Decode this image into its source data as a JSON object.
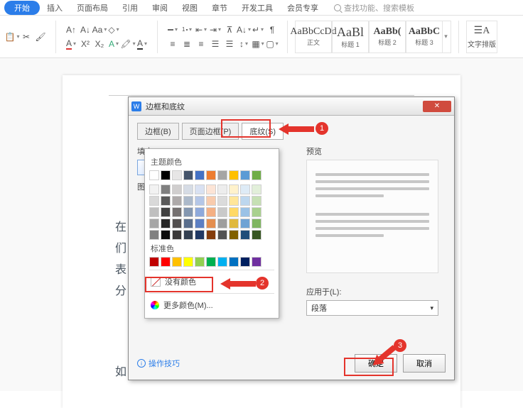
{
  "ribbon": {
    "tabs": {
      "start": "开始",
      "insert": "插入",
      "layout": "页面布局",
      "ref": "引用",
      "review": "审阅",
      "view": "视图",
      "section": "章节",
      "dev": "开发工具",
      "vip": "会员专享"
    },
    "search_placeholder": "查找功能、搜索模板",
    "styles": {
      "s0": {
        "sample": "AaBbCcDd",
        "label": "正文"
      },
      "s1": {
        "sample": "AaBl",
        "label": "标题 1"
      },
      "s2": {
        "sample": "AaBb(",
        "label": "标题 2"
      },
      "s3": {
        "sample": "AaBbC",
        "label": "标题 3"
      }
    },
    "para_arrange": "文字排版"
  },
  "page_text": {
    "l0": "在",
    "l1": "们",
    "l2": "表",
    "l3": "分",
    "l4": "如"
  },
  "dialog": {
    "title": "边框和底纹",
    "tabs": {
      "border": "边框(B)",
      "page_border": "页面边框(P)",
      "shading": "底纹(S)"
    },
    "fill_label": "填充",
    "fill_value": "没有颜色",
    "preview_label": "预览",
    "applyto_label": "应用于(L):",
    "applyto_value": "段落",
    "tips": "操作技巧",
    "ok": "确定",
    "cancel": "取消"
  },
  "color_panel": {
    "theme_label": "主题颜色",
    "std_label": "标准色",
    "no_color": "没有颜色",
    "more_colors": "更多颜色(M)...",
    "theme_row0": [
      "#ffffff",
      "#000000",
      "#e7e6e6",
      "#44546a",
      "#4472c4",
      "#ed7d31",
      "#a5a5a5",
      "#ffc000",
      "#5b9bd5",
      "#70ad47"
    ],
    "theme_shades": [
      [
        "#f2f2f2",
        "#7f7f7f",
        "#d0cece",
        "#d6dce5",
        "#d9e1f2",
        "#fce4d6",
        "#ededed",
        "#fff2cc",
        "#deebf6",
        "#e2efda"
      ],
      [
        "#d9d9d9",
        "#595959",
        "#aeaaaa",
        "#acb9ca",
        "#b4c6e7",
        "#f8cbad",
        "#dbdbdb",
        "#ffe699",
        "#bdd7ee",
        "#c6e0b4"
      ],
      [
        "#bfbfbf",
        "#404040",
        "#757171",
        "#8497b0",
        "#8ea9db",
        "#f4b084",
        "#c9c9c9",
        "#ffd966",
        "#9bc2e6",
        "#a9d08e"
      ],
      [
        "#a6a6a6",
        "#262626",
        "#524f4f",
        "#5a6e8c",
        "#5c7fc3",
        "#e48e4f",
        "#9e9e9e",
        "#e0b93e",
        "#6fa3d4",
        "#7fb560"
      ],
      [
        "#808080",
        "#0d0d0d",
        "#3a3838",
        "#333f50",
        "#203864",
        "#843c0c",
        "#525252",
        "#806000",
        "#1f4e79",
        "#385723"
      ]
    ],
    "std_colors": [
      "#c00000",
      "#ff0000",
      "#ffc000",
      "#ffff00",
      "#92d050",
      "#00b050",
      "#00b0f0",
      "#0070c0",
      "#002060",
      "#7030a0"
    ]
  },
  "badges": {
    "b1": "1",
    "b2": "2",
    "b3": "3"
  }
}
